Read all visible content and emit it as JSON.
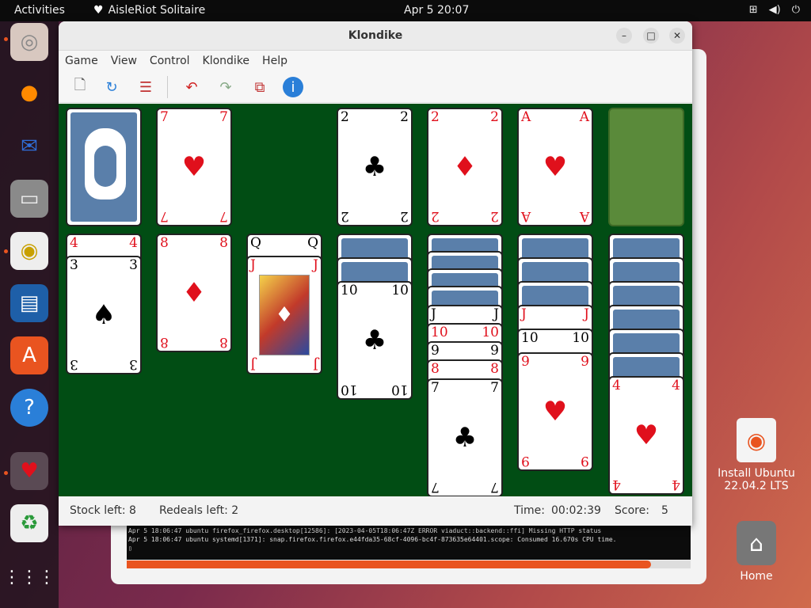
{
  "topbar": {
    "activities": "Activities",
    "app_name": "AisleRiot Solitaire",
    "clock": "Apr 5  20:07"
  },
  "window": {
    "title": "Klondike"
  },
  "menu": [
    "Game",
    "View",
    "Control",
    "Klondike",
    "Help"
  ],
  "statusbar": {
    "stock": "Stock left: 8",
    "redeals": "Redeals left: 2",
    "time_label": "Time:",
    "time_value": "00:02:39",
    "score_label": "Score:",
    "score_value": "5"
  },
  "terminal": {
    "line1": "Apr  5 18:06:47 ubuntu firefox_firefox.desktop[12586]: [2023-04-05T18:06:47Z ERROR viaduct::backend::ffi] Missing HTTP status",
    "line2": "Apr  5 18:06:47 ubuntu systemd[1371]: snap.firefox.firefox.e44fda35-68cf-4096-bc4f-873635e64401.scope: Consumed 16.670s CPU time."
  },
  "install_progress": 0.93,
  "desktop": {
    "install_label": "Install Ubuntu 22.04.2 LTS",
    "home_label": "Home"
  },
  "cards": {
    "seven_hearts": "7",
    "two_clubs": "2",
    "two_diamonds": "2",
    "ace_hearts": "A",
    "four_diamonds": "4",
    "three_spades": "3",
    "eight_diamonds": "8",
    "queen": "Q",
    "jack_clubs": "J",
    "ten_clubs": "10",
    "jack": "J",
    "ten_hearts": "10",
    "nine": "9",
    "eight_hearts": "8",
    "seven_clubs": "7",
    "jack_hearts": "J",
    "ten_spades": "10",
    "nine_hearts": "9",
    "four_hearts": "4"
  },
  "suits": {
    "heart": "♥",
    "diamond": "♦",
    "club": "♣",
    "spade": "♠"
  },
  "colors": {
    "felt": "#014d14",
    "accent": "#e95420",
    "red_suit": "#e0101c"
  }
}
